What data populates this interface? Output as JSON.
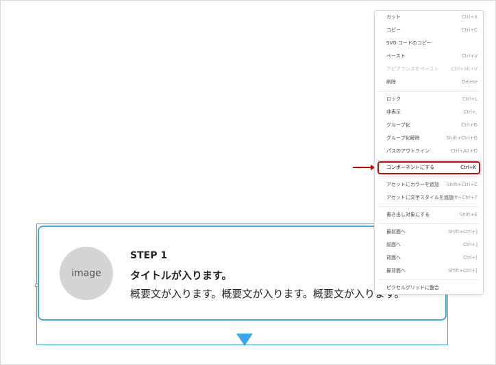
{
  "card": {
    "image_label": "image",
    "step": "STEP 1",
    "title": "タイトルが入ります。",
    "description": "概要文が入ります。概要文が入ります。概要文が入ります。"
  },
  "menu": {
    "items": [
      {
        "label": "カット",
        "shortcut": "Ctrl+X"
      },
      {
        "label": "コピー",
        "shortcut": "Ctrl+C"
      },
      {
        "label": "SVG コードのコピー",
        "shortcut": ""
      },
      {
        "label": "ペースト",
        "shortcut": "Ctrl+V"
      },
      {
        "label": "アピアランスをペースト",
        "shortcut": "Ctrl+Alt+V",
        "disabled": true
      },
      {
        "label": "削除",
        "shortcut": "Delete"
      },
      {
        "label": "ロック",
        "shortcut": "Ctrl+L"
      },
      {
        "label": "非表示",
        "shortcut": "Ctrl+,"
      },
      {
        "label": "グループ化",
        "shortcut": "Ctrl+G"
      },
      {
        "label": "グループ化解除",
        "shortcut": "Shift+Ctrl+G"
      },
      {
        "label": "パスのアウトライン",
        "shortcut": "Ctrl+Alt+O"
      },
      {
        "label": "コンポーネントにする",
        "shortcut": "Ctrl+K",
        "highlighted": true
      },
      {
        "label": "アセットにカラーを追加",
        "shortcut": "Shift+Ctrl+C"
      },
      {
        "label": "アセットに文字スタイルを追加",
        "shortcut": "Shift+Ctrl+T"
      },
      {
        "label": "書き出し対象にする",
        "shortcut": "Shift+E"
      },
      {
        "label": "最前面へ",
        "shortcut": "Shift+Ctrl+]"
      },
      {
        "label": "前面へ",
        "shortcut": "Ctrl+]"
      },
      {
        "label": "背面へ",
        "shortcut": "Ctrl+["
      },
      {
        "label": "最背面へ",
        "shortcut": "Shift+Ctrl+["
      },
      {
        "label": "ピクセルグリッドに整合",
        "shortcut": ""
      }
    ]
  },
  "colors": {
    "selection": "#3ba7f0",
    "highlight": "#e10000"
  }
}
